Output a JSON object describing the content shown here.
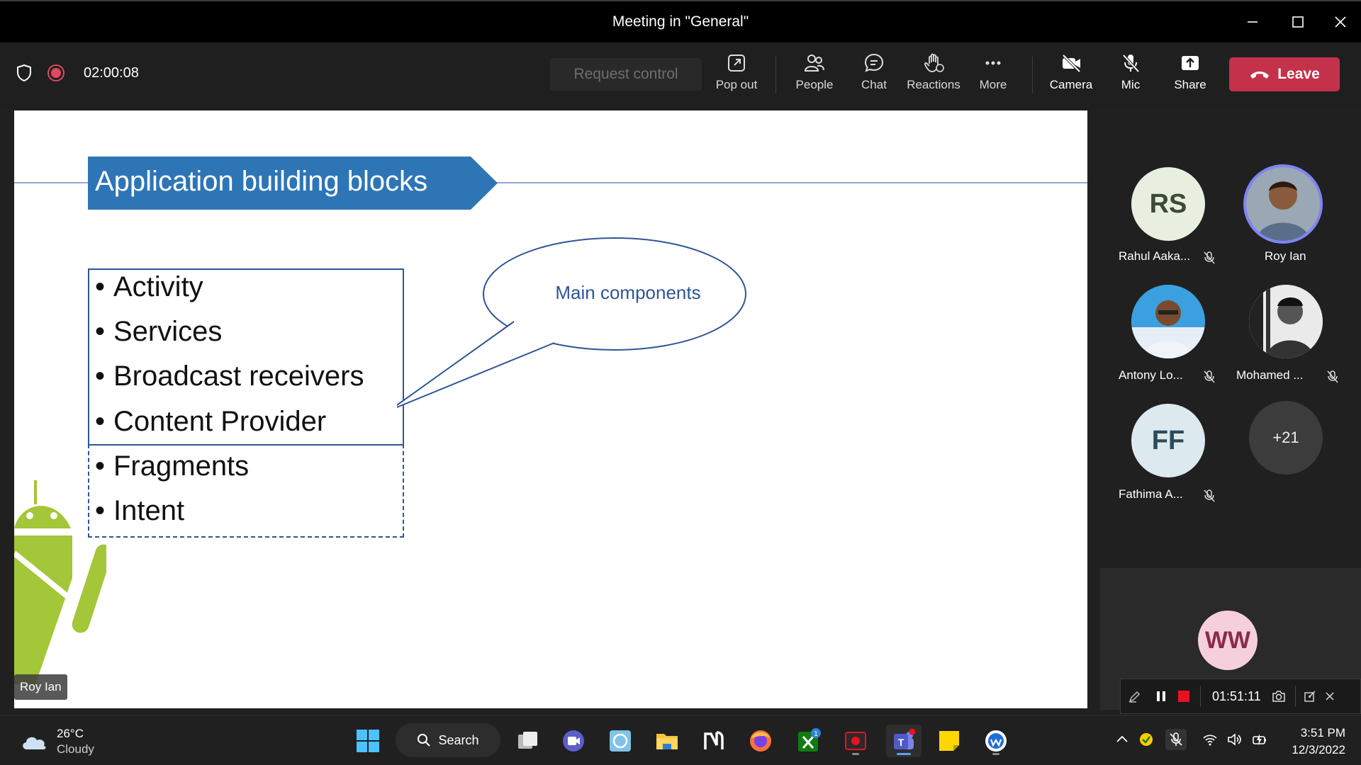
{
  "window": {
    "title": "Meeting in \"General\""
  },
  "toolbar": {
    "elapsed": "02:00:08",
    "request_control": "Request control",
    "pop_out": "Pop out",
    "people": "People",
    "chat": "Chat",
    "reactions": "Reactions",
    "more": "More",
    "camera": "Camera",
    "mic": "Mic",
    "share": "Share",
    "leave": "Leave"
  },
  "slide": {
    "title": "Application building blocks",
    "bullets_main": [
      "Activity",
      "Services",
      "Broadcast receivers",
      "Content Provider"
    ],
    "bullets_extra": [
      "Fragments",
      "Intent"
    ],
    "callout": "Main components",
    "presenter": "Roy Ian"
  },
  "participants": [
    {
      "initials": "RS",
      "name": "Rahul Aaka...",
      "muted": true
    },
    {
      "initials": "",
      "name": "Roy Ian",
      "muted": false,
      "speaking": true
    },
    {
      "initials": "",
      "name": "Antony Lo...",
      "muted": true
    },
    {
      "initials": "",
      "name": "Mohamed ...",
      "muted": true
    },
    {
      "initials": "FF",
      "name": "Fathima A...",
      "muted": true
    },
    {
      "initials": "+21",
      "name": "",
      "muted": false
    }
  ],
  "self_view": {
    "initials": "WW"
  },
  "recorder": {
    "time": "01:51:11"
  },
  "taskbar": {
    "weather_temp": "26°C",
    "weather_cond": "Cloudy",
    "search": "Search",
    "xbox_badge": "1",
    "time": "3:51 PM",
    "date": "12/3/2022"
  },
  "colors": {
    "leave": "#c4314b",
    "slide_accent": "#2e75b6",
    "speaking_ring": "#7f85f5"
  }
}
